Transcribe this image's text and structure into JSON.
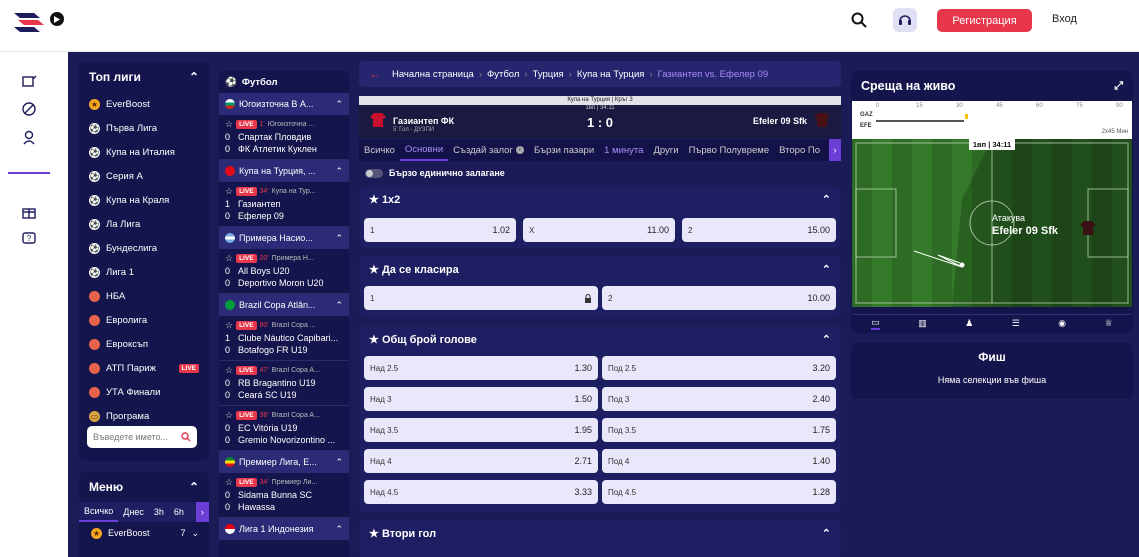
{
  "header": {
    "register": "Регистрация",
    "login": "Вход"
  },
  "top_leagues": {
    "title": "Топ лиги",
    "items": [
      {
        "label": "EverBoost",
        "icon": "star-badge",
        "live": false
      },
      {
        "label": "Първа Лига",
        "icon": "football",
        "live": false
      },
      {
        "label": "Купа на Италия",
        "icon": "football",
        "live": false
      },
      {
        "label": "Серия А",
        "icon": "football",
        "live": false
      },
      {
        "label": "Купа на Краля",
        "icon": "football",
        "live": false
      },
      {
        "label": "Ла Лига",
        "icon": "football",
        "live": false
      },
      {
        "label": "Бундеслига",
        "icon": "football",
        "live": false
      },
      {
        "label": "Лига 1",
        "icon": "football",
        "live": false
      },
      {
        "label": "НБА",
        "icon": "basketball",
        "live": false
      },
      {
        "label": "Евролига",
        "icon": "basketball",
        "live": false
      },
      {
        "label": "Евроксъп",
        "icon": "basketball",
        "live": false
      },
      {
        "label": "АТП Париж",
        "icon": "tennis",
        "live": true
      },
      {
        "label": "УТА Финали",
        "icon": "tennis",
        "live": false
      },
      {
        "label": "Програма",
        "icon": "ticket",
        "live": false
      }
    ],
    "search_placeholder": "Въведете името...",
    "live_label": "LIVE"
  },
  "menu": {
    "title": "Меню",
    "tabs": [
      "Всичко",
      "Днес",
      "3h",
      "6h"
    ],
    "first_item": "EverBoost",
    "first_count": "7"
  },
  "live_events": {
    "sport": "Футбол",
    "groups": [
      {
        "league": "Югоизточна В А...",
        "events": [
          {
            "minute": "1'",
            "comp": "Югоизточна ...",
            "home": "Спартак Пловдив",
            "away": "ФК Атлетик Куклен",
            "hs": "0",
            "as": "0"
          }
        ]
      },
      {
        "league": "Купа на Турция, ...",
        "events": [
          {
            "minute": "34'",
            "comp": "Купа на Тур...",
            "home": "Газиантеп",
            "away": "Ефелер 09",
            "hs": "1",
            "as": "0"
          }
        ]
      },
      {
        "league": "Примера Насио...",
        "events": [
          {
            "minute": "20'",
            "comp": "Примера Н...",
            "home": "All Boys U20",
            "away": "Deportivo Moron U20",
            "hs": "0",
            "as": "0"
          }
        ]
      },
      {
        "league": "Brazil Copa Atlân...",
        "events": [
          {
            "minute": "80'",
            "comp": "Brazil Copa ...",
            "home": "Clube Náutico Capibari...",
            "away": "Botafogo FR U19",
            "hs": "1",
            "as": "0"
          },
          {
            "minute": "47'",
            "comp": "Brazil Copa A...",
            "home": "RB Bragantino U19",
            "away": "Ceará SC U19",
            "hs": "0",
            "as": "0"
          },
          {
            "minute": "36'",
            "comp": "Brazil Copa A...",
            "home": "EC Vitória U19",
            "away": "Gremio Novorizontino ...",
            "hs": "0",
            "as": "0"
          }
        ]
      },
      {
        "league": "Премиер Лига, Е...",
        "events": [
          {
            "minute": "34'",
            "comp": "Премиер Ли...",
            "home": "Sidama Bunna SC",
            "away": "Hawassa",
            "hs": "0",
            "as": "0"
          }
        ]
      },
      {
        "league": "Лига 1 Индонезия",
        "events": []
      }
    ]
  },
  "breadcrumb": [
    "Начална страница",
    "Футбол",
    "Турция",
    "Купа на Турция",
    "Газиантеп vs. Ефелер 09"
  ],
  "match": {
    "competition": "Купа на Турция | Кръг 3",
    "period": "1вп | 34:11",
    "home": "Газиантеп ФК",
    "away": "Efeler 09 Sfk",
    "score": "1 : 0",
    "info": "5' Гол - ДУЗПИ"
  },
  "tabs": [
    "Всичко",
    "Основни",
    "Създай залог",
    "Бързи пазари",
    "1 минута",
    "Други",
    "Първо Полувреме",
    "Второ По"
  ],
  "quick_bet": "Бързо единично залагане",
  "markets": [
    {
      "title": "1x2",
      "rows": [
        [
          {
            "l": "1",
            "v": "1.02"
          },
          {
            "l": "X",
            "v": "11.00"
          },
          {
            "l": "2",
            "v": "15.00"
          }
        ]
      ]
    },
    {
      "title": "Да се класира",
      "rows": [
        [
          {
            "l": "1",
            "v": ""
          },
          {
            "l": "2",
            "v": "10.00"
          }
        ]
      ]
    },
    {
      "title": "Общ брой голове",
      "rows": [
        [
          {
            "l": "Над 2.5",
            "v": "1.30"
          },
          {
            "l": "Под 2.5",
            "v": "3.20"
          }
        ],
        [
          {
            "l": "Над 3",
            "v": "1.50"
          },
          {
            "l": "Под 3",
            "v": "2.40"
          }
        ],
        [
          {
            "l": "Над 3.5",
            "v": "1.95"
          },
          {
            "l": "Под 3.5",
            "v": "1.75"
          }
        ],
        [
          {
            "l": "Над 4",
            "v": "2.71"
          },
          {
            "l": "Под 4",
            "v": "1.40"
          }
        ],
        [
          {
            "l": "Над 4.5",
            "v": "3.33"
          },
          {
            "l": "Под 4.5",
            "v": "1.28"
          }
        ]
      ]
    },
    {
      "title": "Втори гол",
      "rows": []
    }
  ],
  "live_match": {
    "title": "Среща на живо",
    "timeline_ticks": [
      "0",
      "15",
      "30",
      "45",
      "60",
      "75",
      "90"
    ],
    "team_a": "GAZ",
    "team_b": "EFE",
    "extra": "2x45 Мин",
    "clock": "1вп | 34:11",
    "attack_label": "Атакува",
    "attack_team": "Efeler 09 Sfk"
  },
  "betslip": {
    "title": "Фиш",
    "empty": "Няма селекции във фиша"
  }
}
